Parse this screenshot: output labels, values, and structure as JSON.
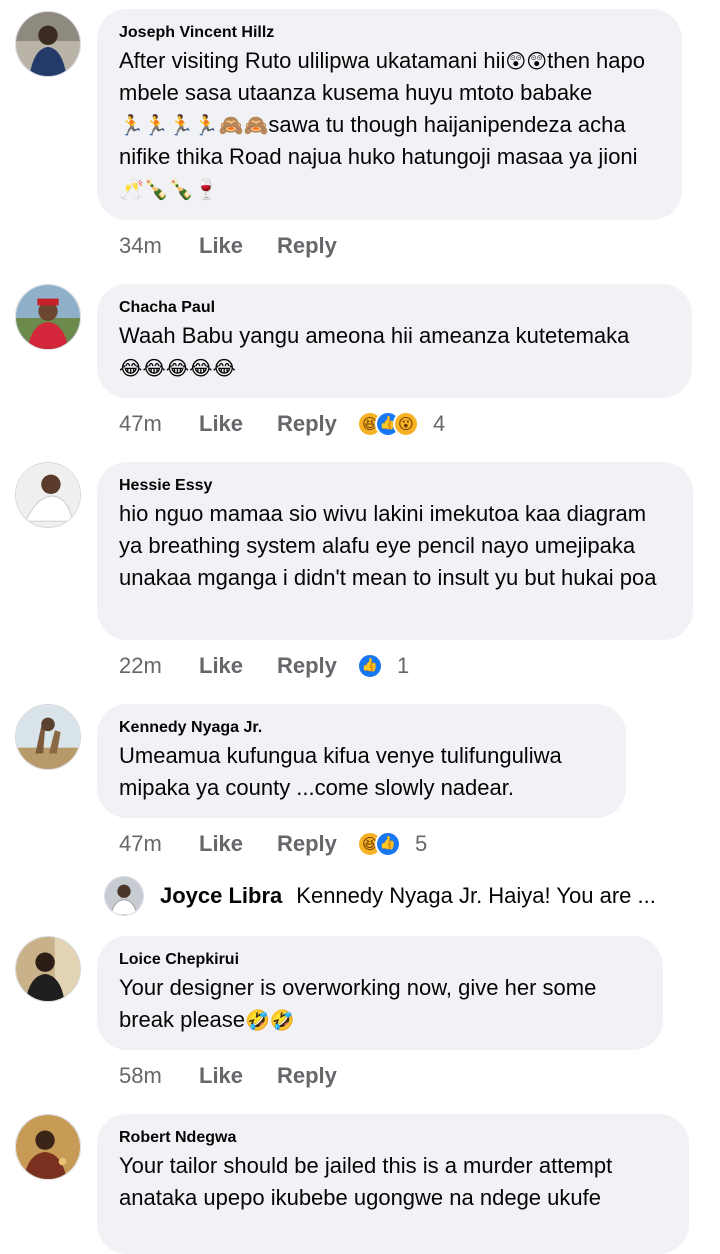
{
  "comments": [
    {
      "author": "Joseph Vincent Hillz",
      "text": "After visiting Ruto ulilipwa ukatamani hii",
      "emoji1": "😲😲",
      "text2": "then hapo mbele sasa utaanza kusema huyu mtoto babake",
      "emoji2": "🏃🏃🏃🏃🙈🙈",
      "text3": "sawa tu though haijanipendeza acha nifike thika Road najua huko hatungoji masaa ya jioni",
      "emoji3": "🥂🍾🍾🍷",
      "time": "34m",
      "like": "Like",
      "reply": "Reply"
    },
    {
      "author": "Chacha Paul",
      "text": "Waah Babu yangu ameona hii ameanza kutetemaka",
      "emoji1": "😂😂😂😂😂",
      "time": "47m",
      "like": "Like",
      "reply": "Reply",
      "reaction_count": "4"
    },
    {
      "author": "Hessie Essy",
      "text": "hio nguo mamaa sio wivu lakini imekutoa kaa diagram ya breathing system alafu eye pencil nayo umejipaka unakaa mganga i didn't mean to insult yu but hukai poa",
      "time": "22m",
      "like": "Like",
      "reply": "Reply",
      "reaction_count": "1"
    },
    {
      "author": "Kennedy Nyaga Jr.",
      "text": "Umeamua kufungua kifua venye tulifunguliwa mipaka ya county ...come slowly nadear.",
      "time": "47m",
      "like": "Like",
      "reply": "Reply",
      "reaction_count": "5"
    },
    {
      "author": "Loice Chepkirui",
      "text": "Your designer is overworking now, give her some break please",
      "emoji1": "🤣🤣",
      "time": "58m",
      "like": "Like",
      "reply": "Reply"
    },
    {
      "author": "Robert Ndegwa",
      "text": "Your tailor should be jailed this is a murder attempt anataka upepo ikubebe ugongwe na ndege ukufe"
    }
  ],
  "reply_preview": {
    "author": "Joyce Libra",
    "text": "Kennedy Nyaga Jr. Haiya! You are ..."
  },
  "colors": {
    "bubble": "#f0f2f5",
    "meta_text": "#65676b",
    "like_blue": "#1877f2",
    "haha_yellow": "#f7b125"
  }
}
